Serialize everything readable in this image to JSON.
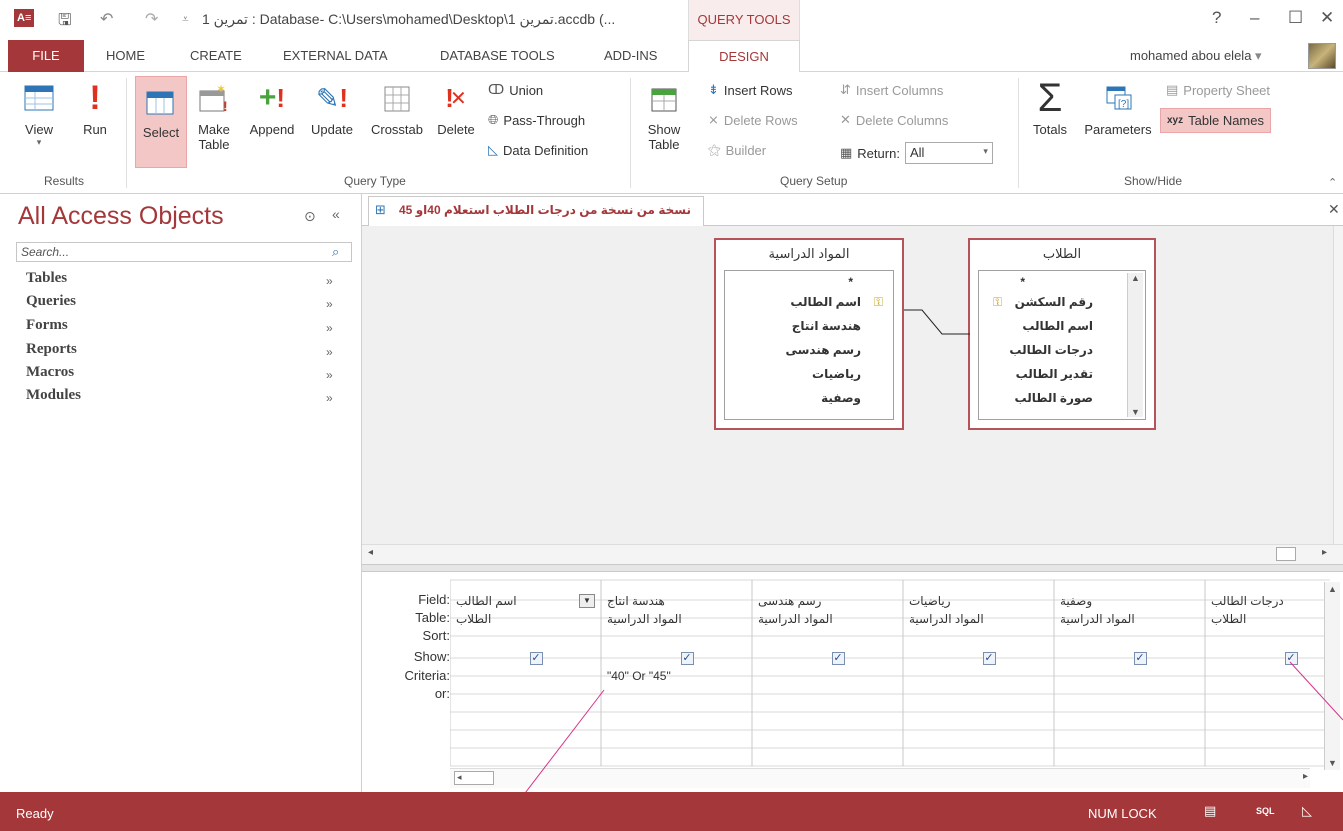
{
  "titlebar": {
    "title": "تمرين 1 : Database- C:\\Users\\mohamed\\Desktop\\تمرين 1.accdb (...",
    "query_tools_label": "QUERY TOOLS",
    "help": "?",
    "minimize": "–",
    "restore": "☐",
    "close": "✕"
  },
  "tabs": {
    "file": "FILE",
    "home": "HOME",
    "create": "CREATE",
    "external_data": "EXTERNAL DATA",
    "database_tools": "DATABASE TOOLS",
    "add_ins": "ADD-INS",
    "design": "DESIGN",
    "user": "mohamed abou elela"
  },
  "ribbon": {
    "results": {
      "view": "View",
      "run": "Run",
      "label": "Results"
    },
    "query_type": {
      "select": "Select",
      "make_table_1": "Make",
      "make_table_2": "Table",
      "append": "Append",
      "update": "Update",
      "crosstab": "Crosstab",
      "delete": "Delete",
      "union": "Union",
      "pass_through": "Pass-Through",
      "data_definition": "Data Definition",
      "label": "Query Type"
    },
    "query_setup": {
      "show_table_1": "Show",
      "show_table_2": "Table",
      "insert_rows": "Insert Rows",
      "delete_rows": "Delete Rows",
      "builder": "Builder",
      "insert_columns": "Insert Columns",
      "delete_columns": "Delete Columns",
      "return_label": "Return:",
      "return_value": "All",
      "label": "Query Setup"
    },
    "show_hide": {
      "totals": "Totals",
      "parameters": "Parameters",
      "property_sheet": "Property Sheet",
      "table_names": "Table Names",
      "label": "Show/Hide"
    }
  },
  "nav": {
    "title": "All Access Objects",
    "search_placeholder": "Search...",
    "items": [
      "Tables",
      "Queries",
      "Forms",
      "Reports",
      "Macros",
      "Modules"
    ]
  },
  "document": {
    "tab_title": "نسخة من نسخة من درجات الطلاب استعلام 40او 45",
    "table1": {
      "name": "المواد الدراسية",
      "fields": [
        "*",
        "اسم الطالب",
        "هندسة انتاج",
        "رسم هندسى",
        "رياضيات",
        "وصفية"
      ]
    },
    "table2": {
      "name": "الطلاب",
      "fields": [
        "*",
        "رقم السكشن",
        "اسم الطالب",
        "درجات الطالب",
        "تقدير الطالب",
        "صورة الطالب"
      ]
    }
  },
  "grid": {
    "row_labels": [
      "Field:",
      "Table:",
      "Sort:",
      "Show:",
      "Criteria:",
      "or:"
    ],
    "columns": [
      {
        "field": "اسم الطالب",
        "table": "الطلاب",
        "show": true,
        "criteria": ""
      },
      {
        "field": "هندسة انتاج",
        "table": "المواد الدراسية",
        "show": true,
        "criteria": "\"40\" Or \"45\""
      },
      {
        "field": "رسم هندسى",
        "table": "المواد الدراسية",
        "show": true,
        "criteria": ""
      },
      {
        "field": "رياضيات",
        "table": "المواد الدراسية",
        "show": true,
        "criteria": ""
      },
      {
        "field": "وصفية",
        "table": "المواد الدراسية",
        "show": true,
        "criteria": ""
      },
      {
        "field": "درجات الطالب",
        "table": "الطلاب",
        "show": true,
        "criteria": ""
      }
    ]
  },
  "status": {
    "ready": "Ready",
    "num_lock": "NUM LOCK",
    "sql": "SQL"
  },
  "colors": {
    "accent": "#a4373a",
    "highlight": "#f4c7c7"
  }
}
